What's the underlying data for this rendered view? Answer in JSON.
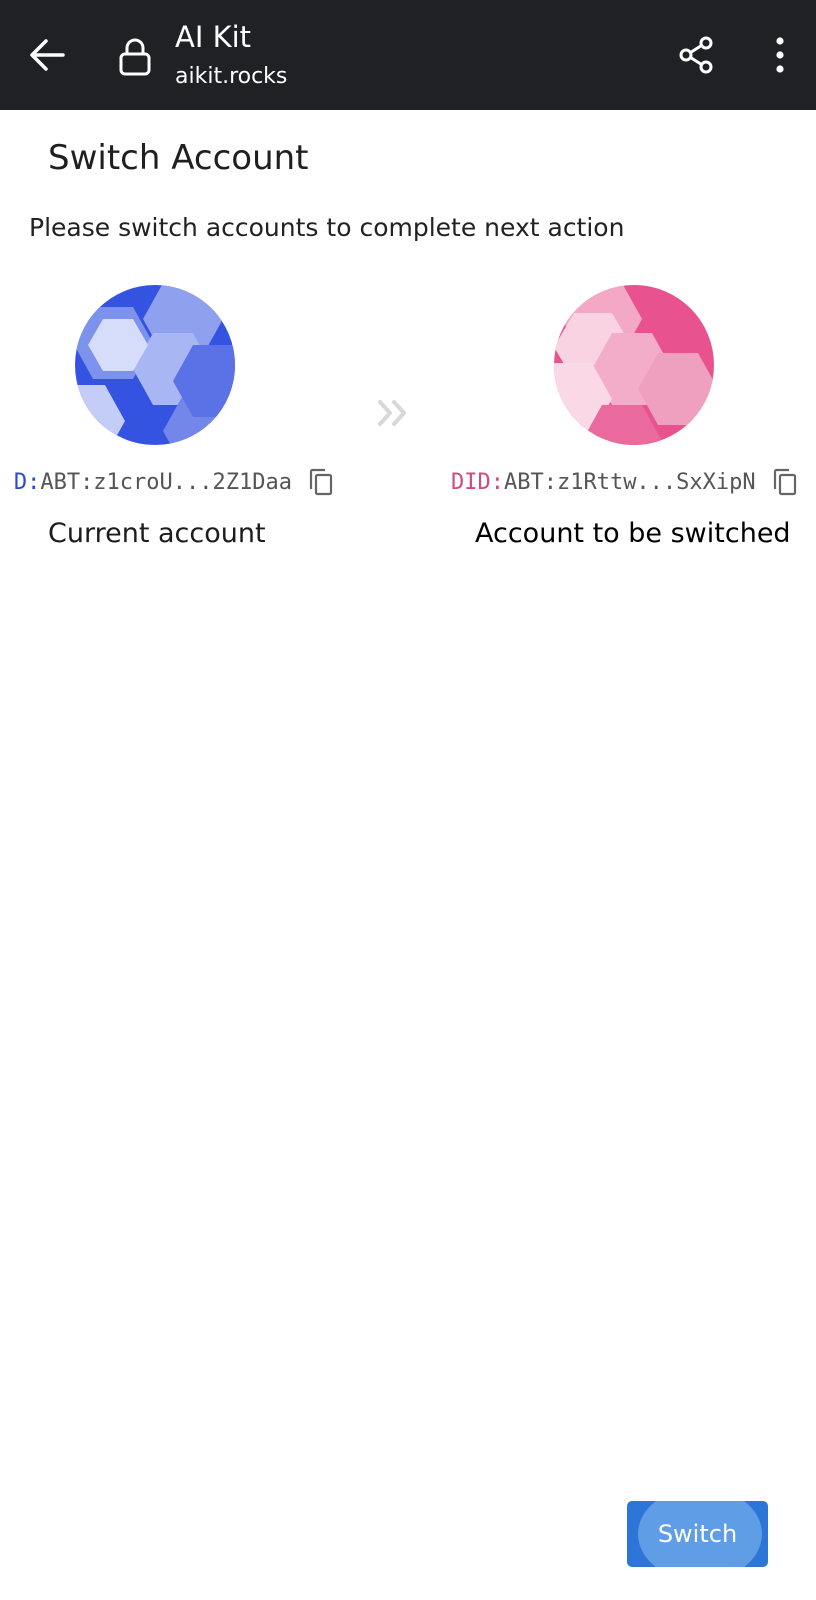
{
  "browser": {
    "title": "AI Kit",
    "url": "aikit.rocks",
    "icons": {
      "back": "arrow-left-icon",
      "lock": "lock-icon",
      "share": "share-icon",
      "more": "more-vert-icon"
    }
  },
  "page": {
    "title": "Switch Account",
    "subtitle": "Please switch accounts to complete next action"
  },
  "accounts": {
    "current": {
      "did_prefix": "D:",
      "did_value": "ABT:z1croU...2Z1Daa",
      "caption": "Current account",
      "color": "#3353e0"
    },
    "target": {
      "did_prefix": "DID:",
      "did_value": "ABT:z1Rttw...SxXipN",
      "caption": "Account to be switched",
      "color": "#e8538f"
    },
    "arrow_icon": "double-chevron-right-icon",
    "copy_icon": "copy-icon"
  },
  "actions": {
    "switch_label": "Switch",
    "accent": "#2d75d6"
  }
}
